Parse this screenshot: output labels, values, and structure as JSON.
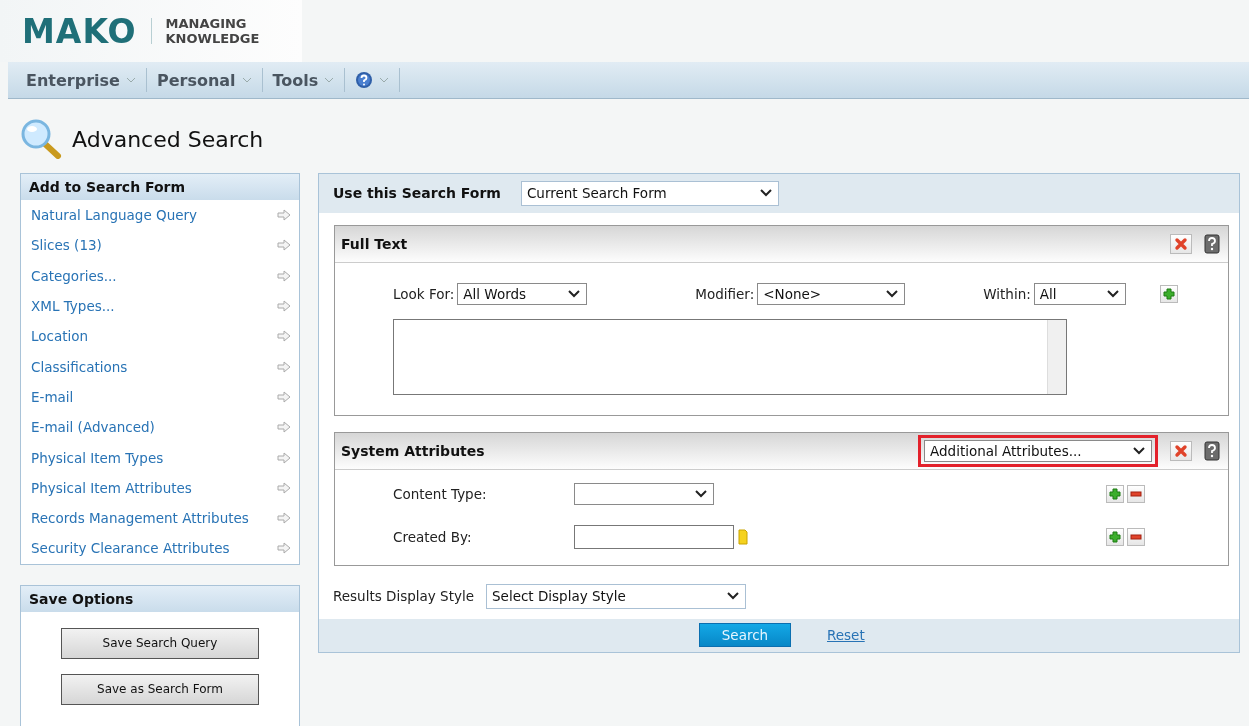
{
  "logo": {
    "brand": "MAKO",
    "tagline_1": "MANAGING",
    "tagline_2": "KNOWLEDGE"
  },
  "nav": [
    {
      "kind": "text",
      "label": "Enterprise"
    },
    {
      "kind": "text",
      "label": "Personal"
    },
    {
      "kind": "text",
      "label": "Tools"
    },
    {
      "kind": "help"
    }
  ],
  "page_title": "Advanced Search",
  "add_panel": {
    "title": "Add to Search Form",
    "items": [
      "Natural Language Query",
      "Slices (13)",
      "Categories...",
      "XML Types...",
      "Location",
      "Classifications",
      "E-mail",
      "E-mail (Advanced)",
      "Physical Item Types",
      "Physical Item Attributes",
      "Records Management Attributes",
      "Security Clearance Attributes"
    ]
  },
  "save_panel": {
    "title": "Save Options",
    "buttons": [
      "Save Search Query",
      "Save as Search Form"
    ]
  },
  "form_selector": {
    "label": "Use this Search Form",
    "value": "Current Search Form"
  },
  "full_text": {
    "title": "Full Text",
    "look_for": {
      "label": "Look For:",
      "value": "All Words"
    },
    "modifier": {
      "label": "Modifier:",
      "value": "<None>"
    },
    "within": {
      "label": "Within:",
      "value": "All"
    }
  },
  "system_attributes": {
    "title": "System Attributes",
    "dropdown": "Additional Attributes...",
    "fields": [
      {
        "kind": "select",
        "label": "Content Type:"
      },
      {
        "kind": "text",
        "label": "Created By:"
      }
    ]
  },
  "results": {
    "label": "Results Display Style",
    "value": "Select Display Style"
  },
  "actions": {
    "search": "Search",
    "reset": "Reset"
  }
}
